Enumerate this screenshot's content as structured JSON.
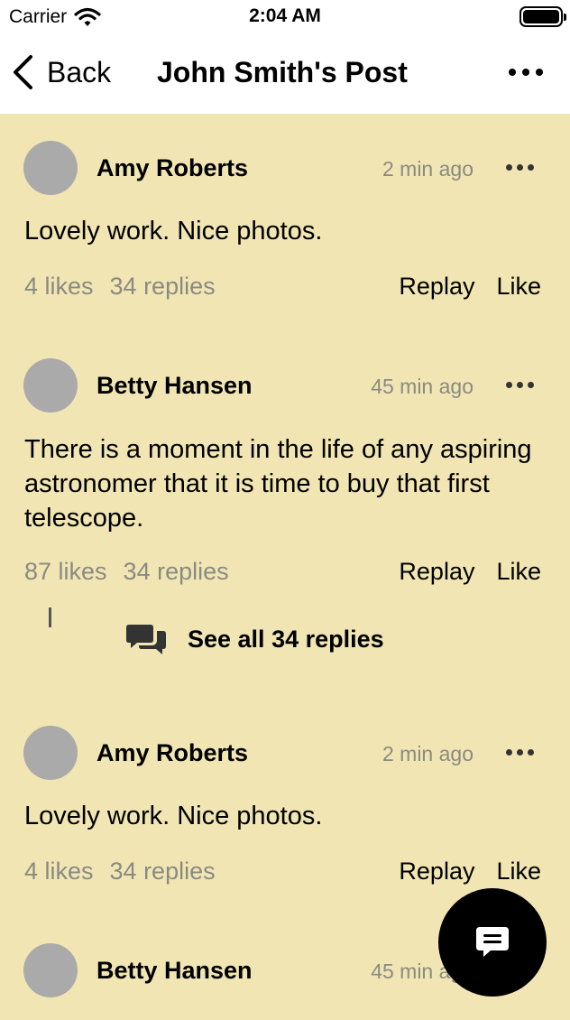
{
  "status_bar": {
    "carrier": "Carrier",
    "time": "2:04 AM"
  },
  "nav": {
    "back_label": "Back",
    "title": "John Smith's Post"
  },
  "comments": [
    {
      "author": "Amy Roberts",
      "ago": "2 min ago",
      "text": "Lovely work. Nice photos.",
      "likes": "4 likes",
      "replies": "34 replies",
      "reply_label": "Replay",
      "like_label": "Like"
    },
    {
      "author": "Betty Hansen",
      "ago": "45 min ago",
      "text": "There is a moment in the life of any aspiring astronomer that it is time to buy that first telescope.",
      "likes": "87 likes",
      "replies": "34 replies",
      "reply_label": "Replay",
      "like_label": "Like",
      "see_all": "See all 34 replies"
    },
    {
      "author": "Amy Roberts",
      "ago": "2 min ago",
      "text": "Lovely work. Nice photos.",
      "likes": "4 likes",
      "replies": "34 replies",
      "reply_label": "Replay",
      "like_label": "Like"
    },
    {
      "author": "Betty Hansen",
      "ago": "45 min ago"
    }
  ],
  "colors": {
    "feed_background": "#f1e6b3",
    "avatar": "#aaaaaa",
    "muted_text": "#8a8a82",
    "fab": "#000000"
  },
  "icons": [
    "wifi-icon",
    "battery-icon",
    "chevron-left-icon",
    "more-horizontal-icon",
    "chat-bubbles-icon",
    "message-icon"
  ]
}
